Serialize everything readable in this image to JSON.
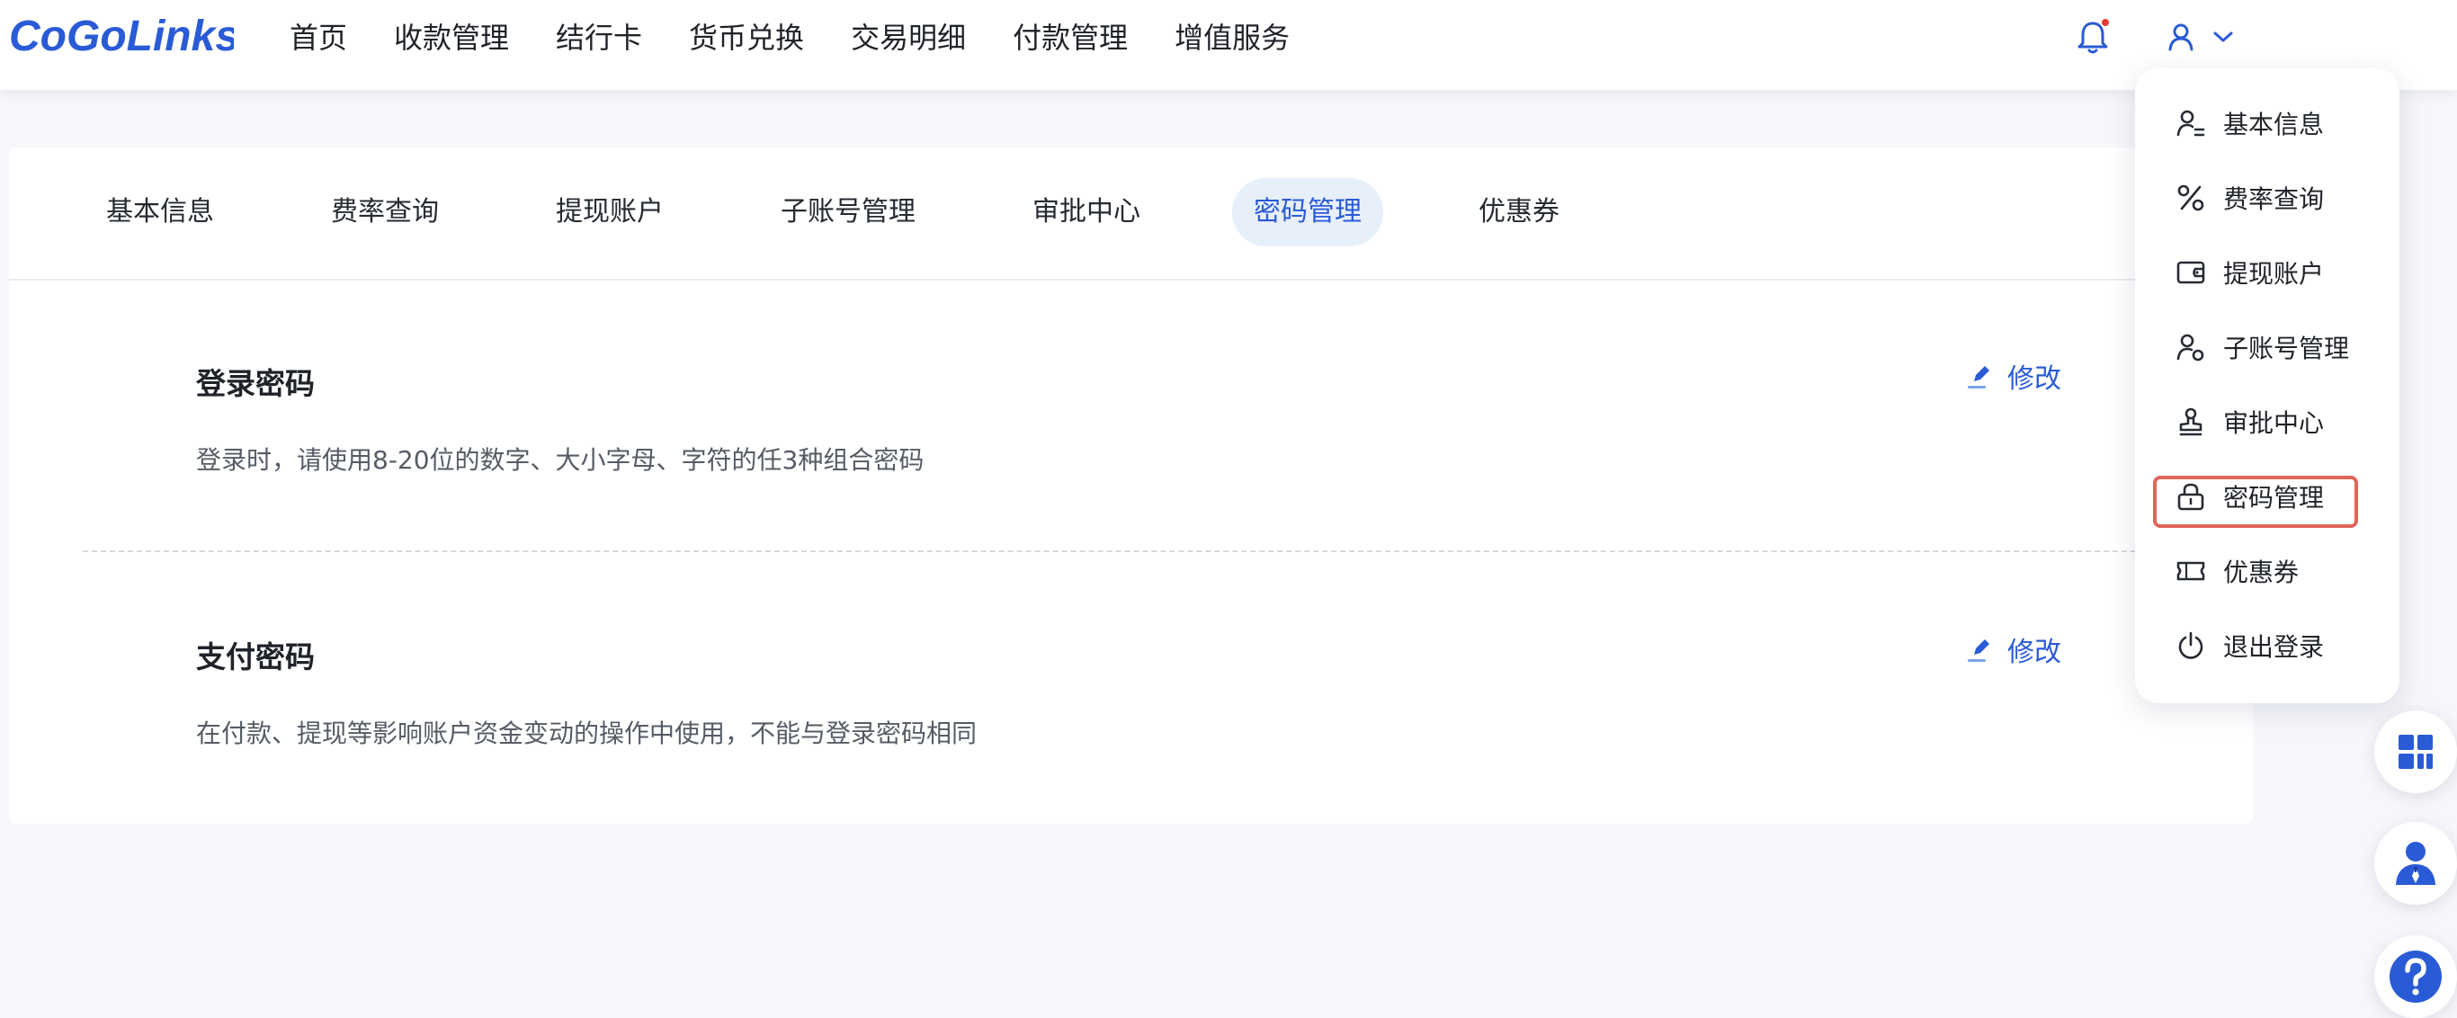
{
  "brand": {
    "logo_text": "CoGoLinks"
  },
  "colors": {
    "accent": "#2a5bd6",
    "notification_dot": "#e53935",
    "highlight_border": "#e0655b",
    "active_tab_bg": "#e7effb"
  },
  "nav": {
    "items": [
      {
        "label": "首页"
      },
      {
        "label": "收款管理"
      },
      {
        "label": "结行卡"
      },
      {
        "label": "货币兑换"
      },
      {
        "label": "交易明细"
      },
      {
        "label": "付款管理"
      },
      {
        "label": "增值服务"
      }
    ]
  },
  "header": {
    "notification_icon": "bell-icon",
    "user_icon": "user-icon",
    "dropdown_icon": "chevron-down-icon"
  },
  "tabs": [
    {
      "label": "基本信息",
      "active": false
    },
    {
      "label": "费率查询",
      "active": false
    },
    {
      "label": "提现账户",
      "active": false
    },
    {
      "label": "子账号管理",
      "active": false
    },
    {
      "label": "审批中心",
      "active": false
    },
    {
      "label": "密码管理",
      "active": true
    },
    {
      "label": "优惠券",
      "active": false
    }
  ],
  "sections": {
    "login": {
      "title": "登录密码",
      "description": "登录时，请使用8-20位的数字、大小字母、字符的任3种组合密码",
      "edit_label": "修改"
    },
    "payment": {
      "title": "支付密码",
      "description": "在付款、提现等影响账户资金变动的操作中使用，不能与登录密码相同",
      "edit_label": "修改"
    }
  },
  "user_menu": {
    "items": [
      {
        "label": "基本信息",
        "icon": "user-info-icon"
      },
      {
        "label": "费率查询",
        "icon": "percent-icon"
      },
      {
        "label": "提现账户",
        "icon": "wallet-icon"
      },
      {
        "label": "子账号管理",
        "icon": "sub-account-icon"
      },
      {
        "label": "审批中心",
        "icon": "stamp-icon"
      },
      {
        "label": "密码管理",
        "icon": "lock-icon",
        "highlighted": true
      },
      {
        "label": "优惠券",
        "icon": "coupon-icon"
      },
      {
        "label": "退出登录",
        "icon": "power-icon"
      }
    ]
  },
  "floating_buttons": [
    {
      "icon": "grid-apps-icon"
    },
    {
      "icon": "customer-service-icon"
    },
    {
      "icon": "help-icon"
    }
  ]
}
